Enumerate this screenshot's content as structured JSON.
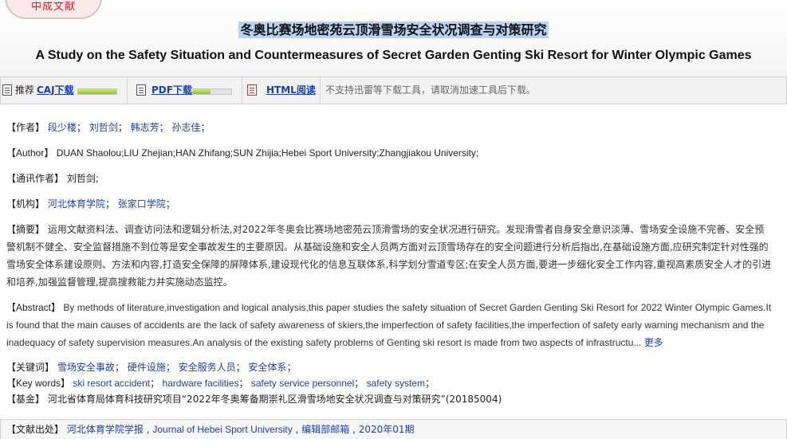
{
  "badge": {
    "text": "中成文献"
  },
  "title": {
    "zh": "冬奥比赛场地密苑云顶滑雪场安全状况调查与对策研究",
    "en": "A Study on the Safety Situation and Countermeasures of Secret Garden Genting Ski Resort for Winter Olympic Games"
  },
  "toolbar": {
    "recommend_label": "推荐",
    "caj_label": "CAJ下载",
    "caj_progress": 1.0,
    "pdf_label": "PDF下载",
    "pdf_progress": 0.45,
    "html_label": "HTML阅读",
    "note": "不支持迅雷等下载工具，请取消加速工具后下载。"
  },
  "authors": {
    "label": "【作者】",
    "names": [
      "段少楼",
      "刘哲剑",
      "韩志芳",
      "孙志佳"
    ]
  },
  "author_en": {
    "label": "【Author】",
    "text": "DUAN Shaolou;LIU Zhejian;HAN Zhifang;SUN Zhijia;Hebei Sport University;Zhangjiakou University;"
  },
  "corresponding": {
    "label": "【通讯作者】",
    "name": "刘哲剑;"
  },
  "institutions": {
    "label": "【机构】",
    "names": [
      "河北体育学院",
      "张家口学院"
    ]
  },
  "abstract_zh": {
    "label": "【摘要】",
    "text": "运用文献资料法、调查访问法和逻辑分析法,对2022年冬奥会比赛场地密苑云顶滑雪场的安全状况进行研究。发现滑雪者自身安全意识淡薄、雪场安全设施不完善、安全预警机制不健全、安全监督措施不到位等是安全事故发生的主要原因。从基础设施和安全人员两方面对云顶雪场存在的安全问题进行分析后指出,在基础设施方面,应研究制定针对性强的雪场安全体系建设原则、方法和内容,打造安全保障的屏障体系,建设现代化的信息互联体系,科学划分雪道专区;在安全人员方面,要进一步细化安全工作内容,重视高素质安全人才的引进和培养,加强监督管理,提高搜救能力并实施动态监控。"
  },
  "abstract_en": {
    "label": "【Abstract】",
    "text": "By methods of literature,investigation and logical analysis,this paper studies the safety situation of Secret Garden Genting Ski Resort for 2022 Winter Olympic Games.It is found that the main causes of accidents are the lack of safety awareness of skiers,the imperfection of safety facilities,the imperfection of safety early warning mechanism and the inadequacy of safety supervision measures.An analysis of the existing safety problems of Genting ski resort is made from two aspects of infrastructu...",
    "more_label": "更多"
  },
  "keywords_zh": {
    "label": "【关键词】",
    "items": [
      "雪场安全事故",
      "硬件设施",
      "安全服务人员",
      "安全体系"
    ]
  },
  "keywords_en": {
    "label": "【Key words】",
    "items": [
      "ski resort accident",
      "hardware facilities",
      "safety service personnel",
      "safety system"
    ]
  },
  "fund": {
    "label": "【基金】",
    "text": "河北省体育局体育科技研究项目“2022年冬奥筹备期崇礼区滑雪场地安全状况调查与对策研究”(20185004)"
  },
  "source": {
    "label": "【文献出处】",
    "journal_zh": "河北体育学院学报",
    "journal_en": "Journal of Hebei Sport University",
    "editor": "编辑部邮箱",
    "issue": "2020年01期"
  }
}
